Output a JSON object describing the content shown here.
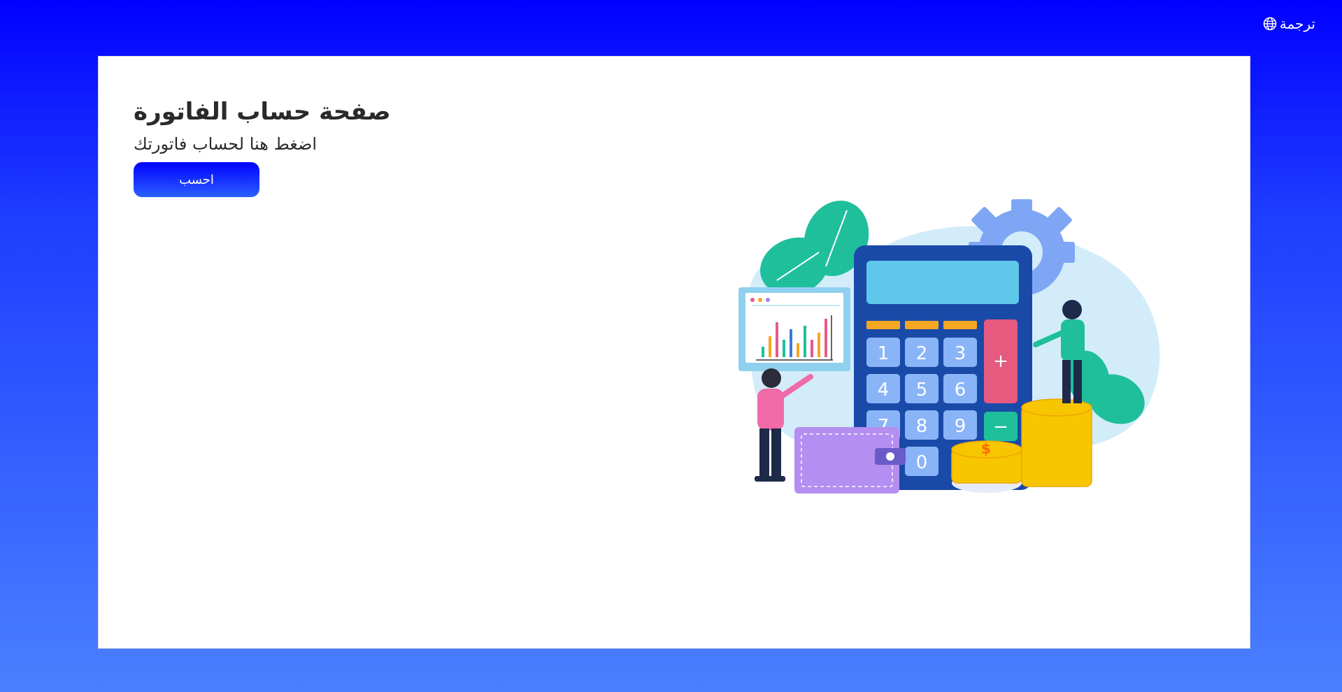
{
  "header": {
    "translate_label": "ترجمة",
    "translate_icon": "globe-icon"
  },
  "main": {
    "title": "صفحة حساب الفاتورة",
    "subtitle": "اضغط هنا لحساب فاتورتك",
    "calculate_button_label": "احسب"
  },
  "illustration": {
    "calculator_keys": [
      "1",
      "2",
      "3",
      "4",
      "5",
      "6",
      "7",
      "8",
      "9",
      "0",
      "+",
      "−"
    ],
    "coin_symbol": "$"
  },
  "colors": {
    "bg_top": "#0000ff",
    "bg_bottom": "#4a80ff",
    "button_top": "#0000ff",
    "button_bottom": "#2b60ff",
    "card": "#ffffff",
    "title_text": "#2a2a2a"
  }
}
